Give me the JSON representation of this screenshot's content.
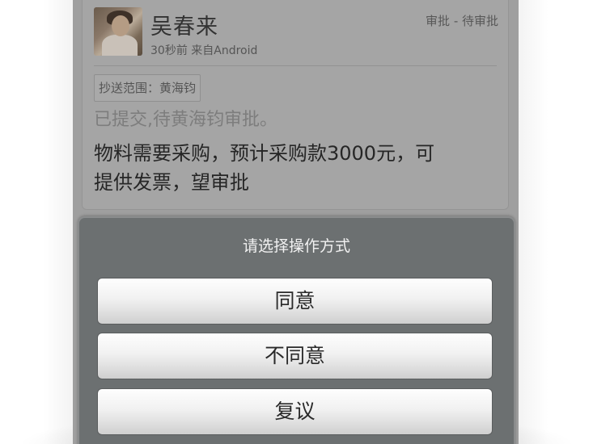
{
  "card": {
    "user_name": "吴春来",
    "meta": "30秒前  来自Android",
    "status": "审批 - 待审批",
    "cc_label": "抄送范围：黄海钧",
    "submitted_text": "已提交,待黄海钧审批。",
    "content_line1": "物料需要采购，预计采购款3000元，可",
    "content_line2": "提供发票，望审批"
  },
  "dialog": {
    "title": "请选择操作方式",
    "options": [
      {
        "label": "同意"
      },
      {
        "label": "不同意"
      },
      {
        "label": "复议"
      }
    ]
  }
}
